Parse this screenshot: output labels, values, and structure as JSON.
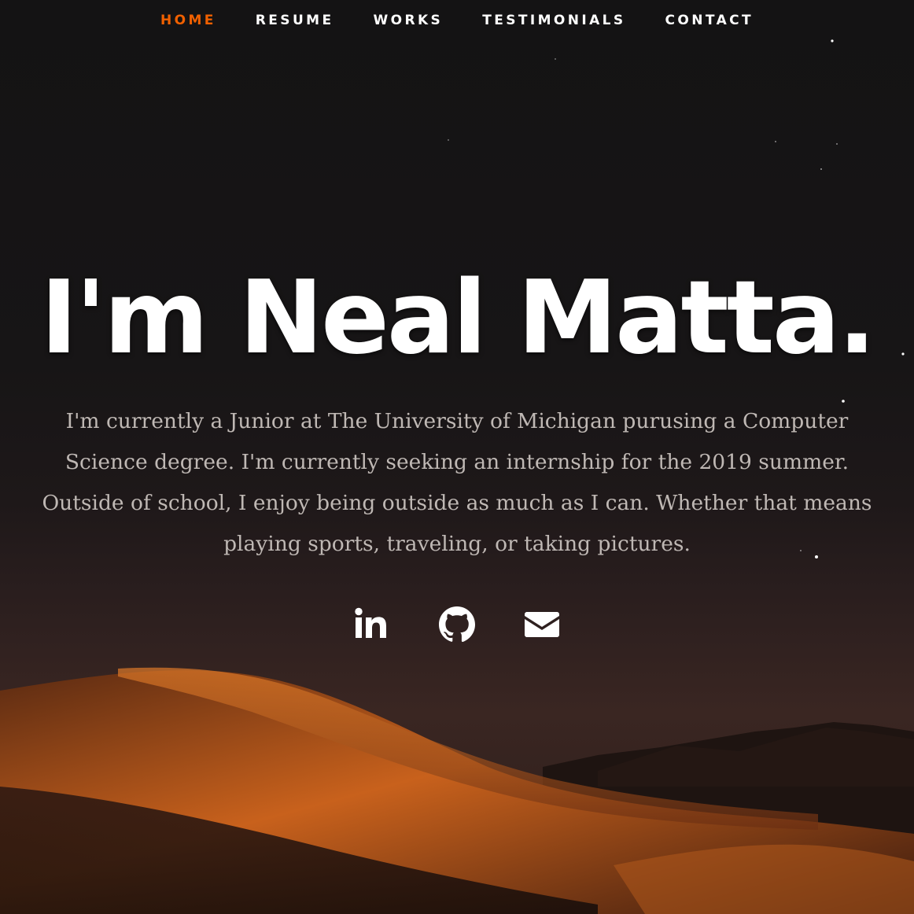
{
  "nav": {
    "items": [
      {
        "label": "HOME",
        "current": true
      },
      {
        "label": "RESUME"
      },
      {
        "label": "WORKS"
      },
      {
        "label": "TESTIMONIALS"
      },
      {
        "label": "CONTACT"
      }
    ]
  },
  "banner": {
    "headline": "I'm Neal Matta.",
    "intro": "I'm currently a Junior at The University of Michigan purusing a Computer Science degree. I'm currently seeking an internship for the 2019 summer. Outside of school, I enjoy being outside as much as I can. Whether that means playing sports, traveling, or taking pictures."
  },
  "social": [
    {
      "icon": "linkedin-icon"
    },
    {
      "icon": "github-icon"
    },
    {
      "icon": "email-icon"
    }
  ],
  "colors": {
    "accent": "#f06000",
    "background": "#141314",
    "text": "#ffffff",
    "intro_text": "#bfb8b4"
  }
}
